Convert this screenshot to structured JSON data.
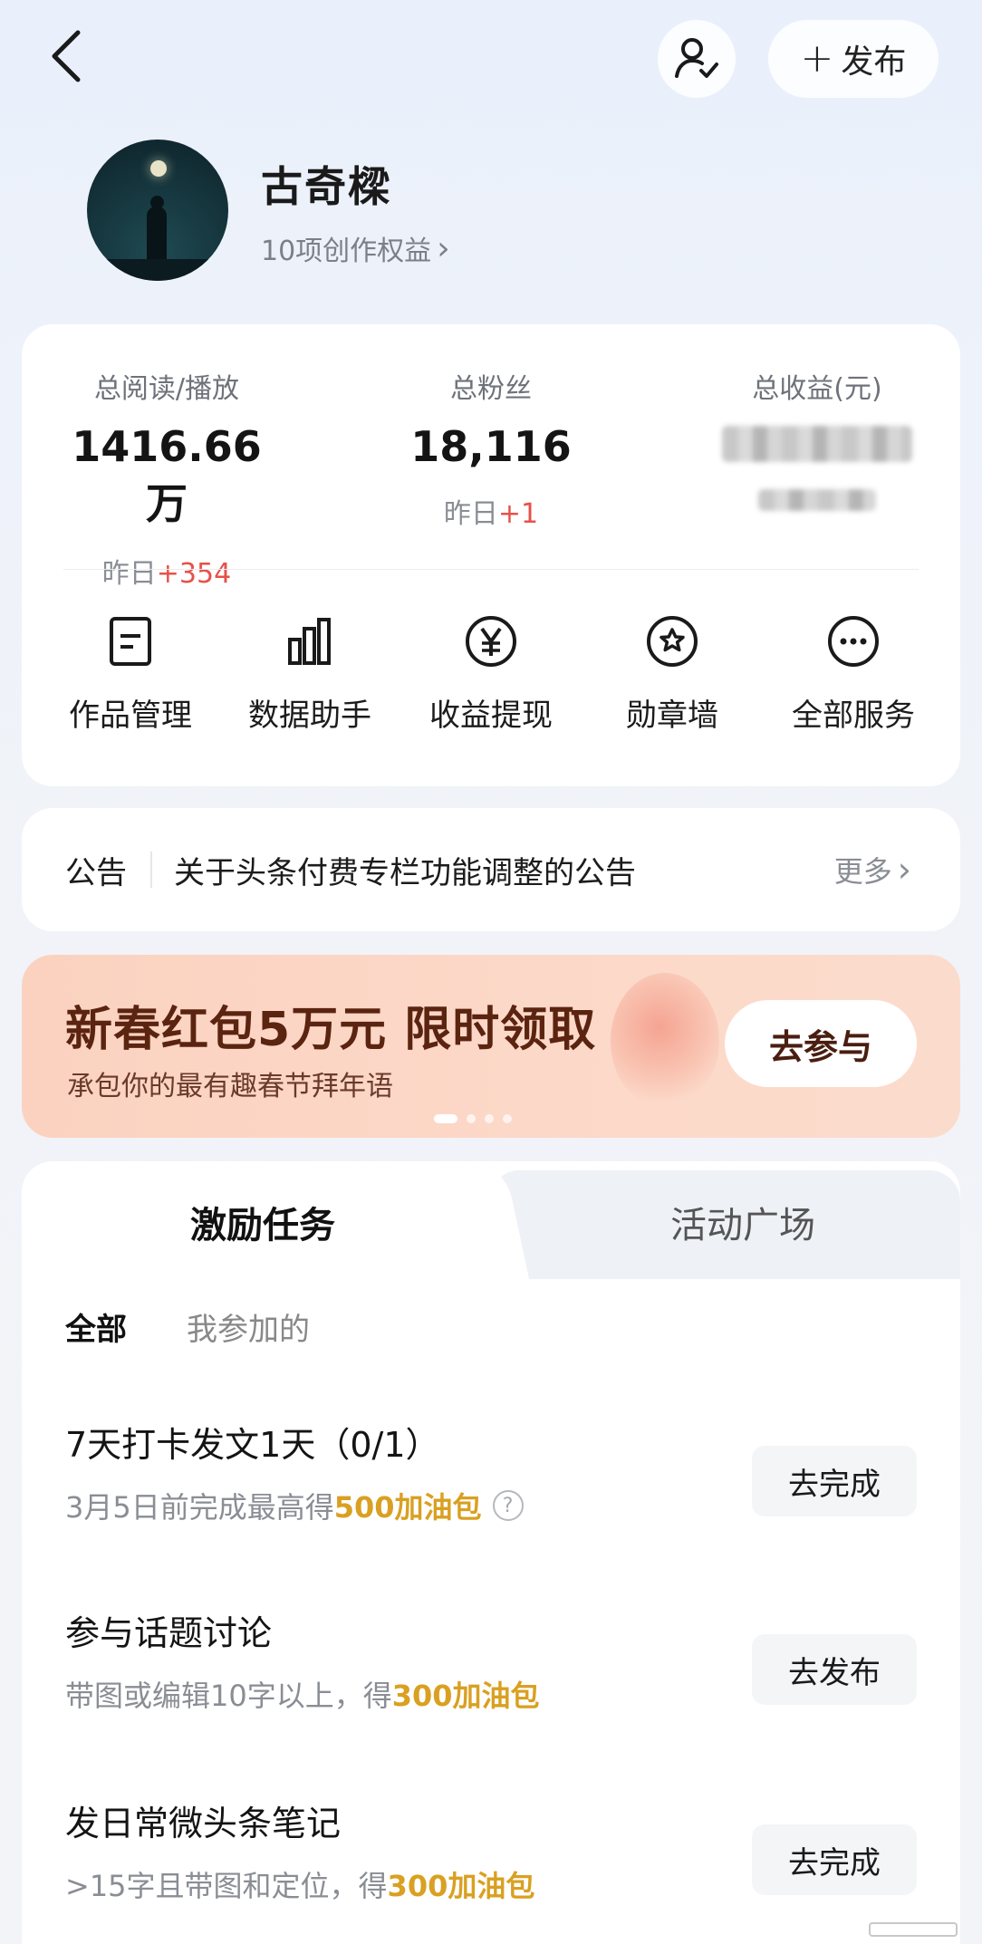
{
  "header": {
    "publish_label": "发布",
    "plus_glyph": "+"
  },
  "profile": {
    "name": "古奇樑",
    "rights": "10项创作权益",
    "rights_chevron": "›"
  },
  "stats": [
    {
      "label": "总阅读/播放",
      "value": "1416.66万",
      "delta_prefix": "昨日",
      "delta": "+354"
    },
    {
      "label": "总粉丝",
      "value": "18,116",
      "delta_prefix": "昨日",
      "delta": "+1"
    },
    {
      "label": "总收益(元)"
    }
  ],
  "services": [
    {
      "label": "作品管理",
      "icon": "document-icon"
    },
    {
      "label": "数据助手",
      "icon": "bar-chart-icon"
    },
    {
      "label": "收益提现",
      "icon": "yen-icon"
    },
    {
      "label": "勋章墙",
      "icon": "medal-icon"
    },
    {
      "label": "全部服务",
      "icon": "more-icon"
    }
  ],
  "notice": {
    "tag": "公告",
    "text": "关于头条付费专栏功能调整的公告",
    "more": "更多",
    "more_chevron": "›"
  },
  "banner": {
    "title": "新春红包5万元 限时领取",
    "subtitle": "承包你的最有趣春节拜年语",
    "button": "去参与",
    "page_count": 4,
    "active_page": 1
  },
  "tasks": {
    "tabs": [
      {
        "label": "激励任务",
        "active": true
      },
      {
        "label": "活动广场",
        "active": false
      }
    ],
    "filters": [
      {
        "label": "全部",
        "active": true
      },
      {
        "label": "我参加的",
        "active": false
      }
    ],
    "items": [
      {
        "title": "7天打卡发文1天（0/1）",
        "desc": "3月5日前完成最高得",
        "reward": "500加油包",
        "help": "?",
        "button": "去完成"
      },
      {
        "title": "参与话题讨论",
        "desc": "带图或编辑10字以上，得",
        "reward": "300加油包",
        "button": "去发布"
      },
      {
        "title": "发日常微头条笔记",
        "desc": ">15字且带图和定位，得",
        "reward": "300加油包",
        "button": "去完成"
      }
    ]
  },
  "colors": {
    "accent_red": "#e5524a",
    "reward_gold": "#d9a021",
    "banner_bg": "#fbd2c0"
  }
}
